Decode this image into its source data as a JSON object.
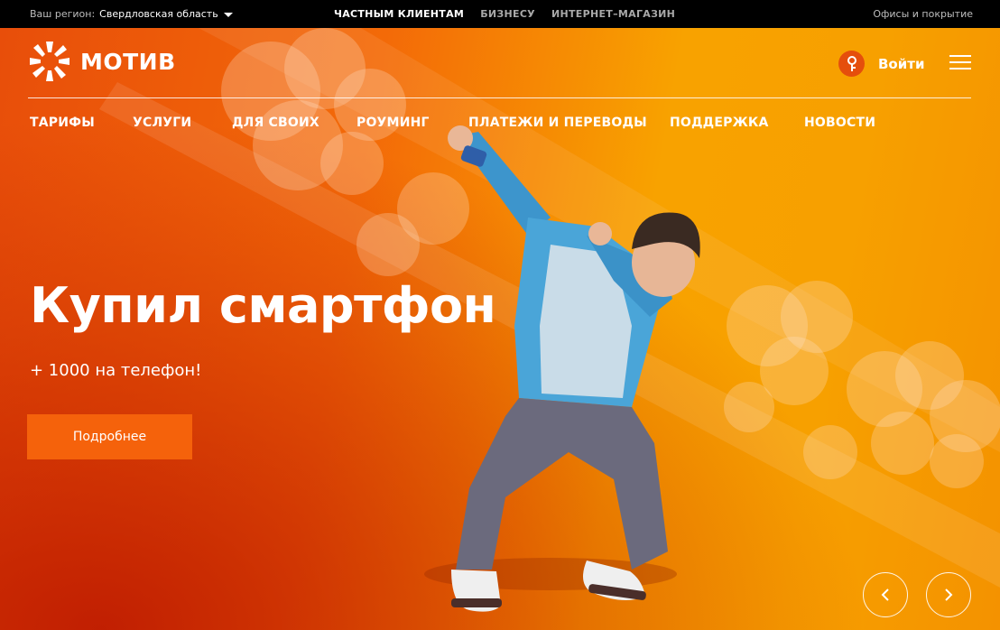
{
  "topbar": {
    "region_label": "Ваш регион:",
    "region_value": "Свердловская область",
    "segments": [
      "ЧАСТНЫМ КЛИЕНТАМ",
      "БИЗНЕСУ",
      "ИНТЕРНЕТ–МАГАЗИН"
    ],
    "active_segment": "ЧАСТНЫМ КЛИЕНТАМ",
    "offices": "Офисы и покрытие"
  },
  "header": {
    "logo_text": "МОТИВ",
    "login_label": "Войти",
    "icons": [
      "key-icon",
      "menu-icon"
    ]
  },
  "nav": [
    "ТАРИФЫ",
    "УСЛУГИ",
    "ДЛЯ СВОИХ",
    "РОУМИНГ",
    "ПЛАТЕЖИ И ПЕРЕВОДЫ",
    "ПОДДЕРЖКА",
    "НОВОСТИ"
  ],
  "hero": {
    "headline": "Купил смартфон",
    "subline": "+ 1000 на телефон!",
    "cta_label": "Подробнее"
  },
  "slider": {
    "prev_icon": "chevron-left-icon",
    "next_icon": "chevron-right-icon"
  },
  "colors": {
    "accent": "#f5620b",
    "topbar_bg": "#000000",
    "hero_orange": "#f36a08"
  }
}
